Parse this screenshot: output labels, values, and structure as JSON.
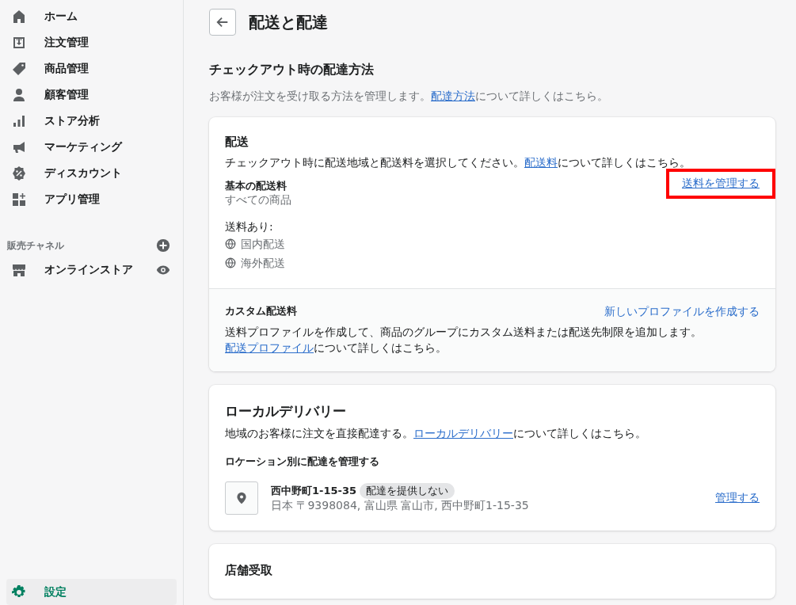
{
  "sidebar": {
    "items": [
      {
        "label": "ホーム",
        "selected": false
      },
      {
        "label": "注文管理",
        "selected": false
      },
      {
        "label": "商品管理",
        "selected": false
      },
      {
        "label": "顧客管理",
        "selected": false
      },
      {
        "label": "ストア分析",
        "selected": false
      },
      {
        "label": "マーケティング",
        "selected": false
      },
      {
        "label": "ディスカウント",
        "selected": false
      },
      {
        "label": "アプリ管理",
        "selected": false
      }
    ],
    "channels_heading": "販売チャネル",
    "channels": [
      {
        "label": "オンラインストア",
        "selected": false
      }
    ],
    "settings": {
      "label": "設定",
      "selected": true
    }
  },
  "page": {
    "title": "配送と配達",
    "section_title": "チェックアウト時の配達方法",
    "section_description": {
      "before": "お客様が注文を受け取る方法を管理します。",
      "link": "配達方法",
      "after": "について詳しくはこちら。"
    },
    "shipping": {
      "title": "配送",
      "description": {
        "before": "チェックアウト時に配送地域と配送料を選択してください。",
        "link": "配送料",
        "after": "について詳しくはこちら。"
      },
      "general_rates_title": "基本の配送料",
      "general_rates_subtitle": "すべての商品",
      "manage_link": {
        "label": "送料を管理する",
        "highlighted": true
      },
      "rates_label": "送料あり:",
      "zones": [
        "国内配送",
        "海外配送"
      ],
      "custom_title": "カスタム配送料",
      "custom_link": "新しいプロファイルを作成する",
      "custom_description": {
        "before": "送料プロファイルを作成して、商品のグループにカスタム送料または配送先制限を追加します。",
        "link": "配送プロファイル",
        "after": "について詳しくはこちら。"
      }
    },
    "local_delivery": {
      "title": "ローカルデリバリー",
      "description": {
        "before": "地域のお客様に注文を直接配達する。",
        "link": "ローカルデリバリー",
        "after": "について詳しくはこちら。"
      },
      "locations_heading": "ロケーション別に配達を管理する",
      "locations": [
        {
          "name": "西中野町1-15-35",
          "badge": "配達を提供しない",
          "address": "日本 〒9398084, 富山県 富山市, 西中野町1-15-35",
          "link": "管理する"
        }
      ]
    },
    "pickup": {
      "title": "店舗受取"
    }
  }
}
